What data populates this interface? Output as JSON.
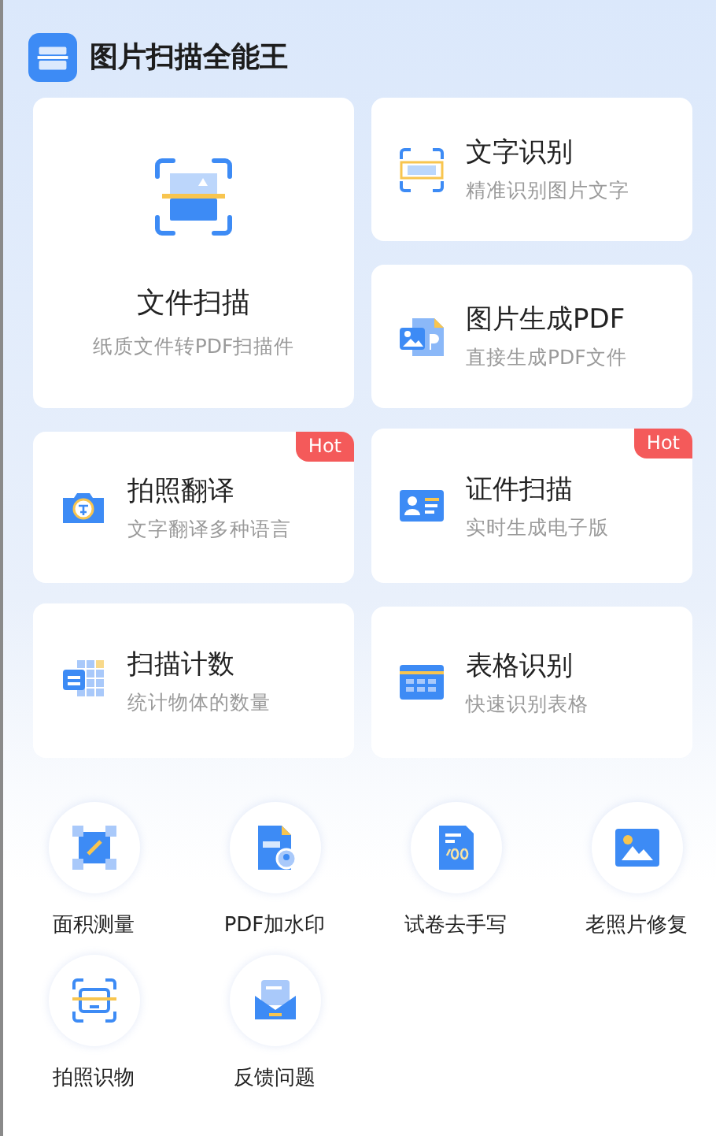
{
  "app": {
    "title": "图片扫描全能王"
  },
  "main_card": {
    "title": "文件扫描",
    "subtitle": "纸质文件转PDF扫描件"
  },
  "side_cards": [
    {
      "kind": "ocr",
      "title": "文字识别",
      "subtitle": "精准识别图片文字"
    },
    {
      "kind": "pdf",
      "title": "图片生成PDF",
      "subtitle": "直接生成PDF文件"
    }
  ],
  "feature_cards": [
    {
      "kind": "translate",
      "title": "拍照翻译",
      "subtitle": "文字翻译多种语言",
      "badge": "Hot"
    },
    {
      "kind": "id",
      "title": "证件扫描",
      "subtitle": "实时生成电子版",
      "badge": "Hot"
    },
    {
      "kind": "count",
      "title": "扫描计数",
      "subtitle": "统计物体的数量"
    },
    {
      "kind": "table",
      "title": "表格识别",
      "subtitle": "快速识别表格"
    }
  ],
  "tools": [
    {
      "kind": "area",
      "label": "面积测量"
    },
    {
      "kind": "watermark",
      "label": "PDF加水印"
    },
    {
      "kind": "exam",
      "label": "试卷去手写"
    },
    {
      "kind": "photo",
      "label": "老照片修复"
    },
    {
      "kind": "object",
      "label": "拍照识物"
    },
    {
      "kind": "feedback",
      "label": "反馈问题"
    }
  ]
}
